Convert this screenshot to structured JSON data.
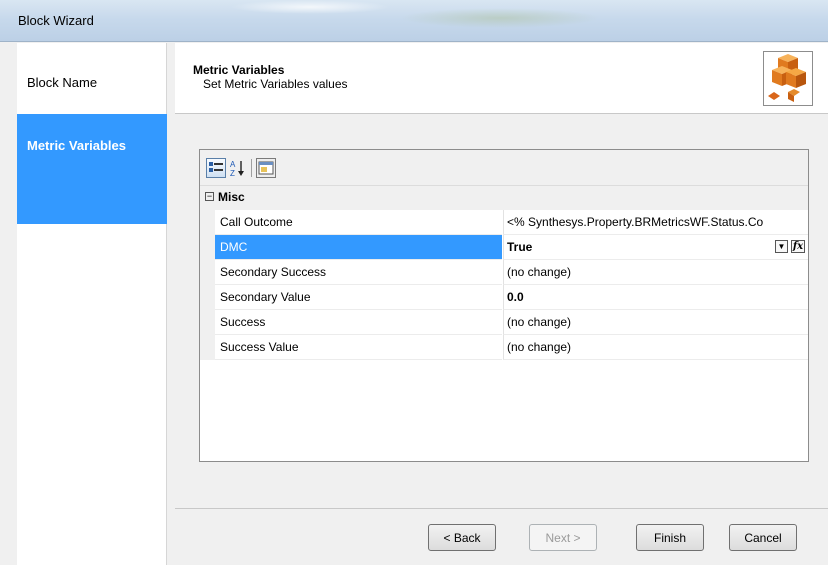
{
  "window": {
    "title": "Block Wizard"
  },
  "nav": {
    "items": [
      {
        "label": "Block Name",
        "selected": false
      },
      {
        "label": "Metric Variables",
        "selected": true
      }
    ]
  },
  "header": {
    "title": "Metric Variables",
    "subtitle": "Set Metric Variables values",
    "icon": "cubes-icon"
  },
  "grid": {
    "toolbar": {
      "categorized_icon": "categorized-icon",
      "alphabetical_icon": "sort-alphabetical-icon",
      "property_pages_icon": "property-pages-icon"
    },
    "category": {
      "expander": "−",
      "label": "Misc"
    },
    "rows": [
      {
        "name": "Call Outcome",
        "value": "<% Synthesys.Property.BRMetricsWF.Status.Co",
        "bold": false,
        "selected": false
      },
      {
        "name": "DMC",
        "value": "True",
        "bold": true,
        "selected": true
      },
      {
        "name": "Secondary Success",
        "value": "(no change)",
        "bold": false,
        "selected": false
      },
      {
        "name": "Secondary Value",
        "value": "0.0",
        "bold": true,
        "selected": false
      },
      {
        "name": "Success",
        "value": "(no change)",
        "bold": false,
        "selected": false
      },
      {
        "name": "Success Value",
        "value": "(no change)",
        "bold": false,
        "selected": false
      }
    ],
    "fx_label": "fx"
  },
  "buttons": {
    "back": "< Back",
    "next": "Next >",
    "finish": "Finish",
    "cancel": "Cancel"
  },
  "colors": {
    "selection": "#3399ff",
    "nav_selected": "#3399ff"
  }
}
